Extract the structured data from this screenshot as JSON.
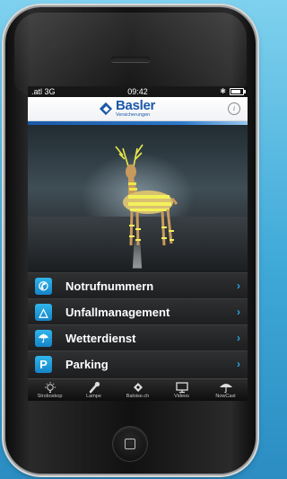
{
  "status_bar": {
    "signal": ".atl 3G",
    "time": "09:42",
    "bluetooth": "✱",
    "battery_level": 0.85
  },
  "header": {
    "logo_name": "Basler",
    "logo_subtitle": "Versicherungen",
    "info_label": "i"
  },
  "menu": {
    "items": [
      {
        "label": "Notrufnummern",
        "icon": "phone-icon",
        "glyph": "✆"
      },
      {
        "label": "Unfallmanagement",
        "icon": "warning-triangle-icon",
        "glyph": "△"
      },
      {
        "label": "Wetterdienst",
        "icon": "umbrella-icon",
        "glyph": "☂"
      },
      {
        "label": "Parking",
        "icon": "parking-icon",
        "glyph": "P"
      }
    ],
    "chevron": "›"
  },
  "tabbar": {
    "tabs": [
      {
        "label": "Stroboskop",
        "icon": "bulb-icon"
      },
      {
        "label": "Lampe",
        "icon": "flashlight-icon"
      },
      {
        "label": "Baloise.ch",
        "icon": "baloise-logo-icon"
      },
      {
        "label": "Videos",
        "icon": "monitor-icon"
      },
      {
        "label": "NowCast",
        "icon": "umbrella-icon"
      }
    ]
  },
  "colors": {
    "accent": "#2aa8e6",
    "brand_blue": "#1a58a8",
    "menu_background": "#1c1d1e",
    "reflective_stripes": "#e8e84a"
  }
}
